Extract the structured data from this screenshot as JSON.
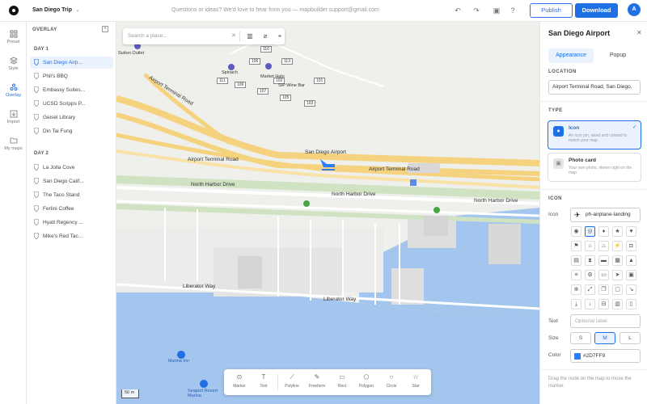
{
  "topbar": {
    "trip_title": "San Diego Trip",
    "feedback": "Questions or ideas? We'd love to hear from you — mapbuilder.support@gmail.com",
    "publish_label": "Publish",
    "download_label": "Download",
    "avatar_initial": "A"
  },
  "rail": {
    "items": [
      {
        "label": "Preset",
        "icon": "grid-icon"
      },
      {
        "label": "Style",
        "icon": "layers-icon"
      },
      {
        "label": "Overlay",
        "icon": "overlay-icon"
      },
      {
        "label": "Import",
        "icon": "import-icon"
      },
      {
        "label": "My maps",
        "icon": "folder-icon"
      }
    ]
  },
  "overlay": {
    "heading": "OVERLAY",
    "day1": {
      "heading": "DAY 1",
      "places": [
        "San Diego Airp...",
        "Phil's BBQ",
        "Embassy Suites...",
        "UCSD Scripps P...",
        "Geisel Library",
        "Din Tai Fung"
      ]
    },
    "day2": {
      "heading": "DAY 2",
      "places": [
        "La Jolla Cove",
        "San Diego Calif...",
        "The Taco Stand",
        "Ferlini Coffee",
        "Hyatt Regency ...",
        "Mike's Red Tac..."
      ]
    }
  },
  "map": {
    "search_placeholder": "Search a place...",
    "labels": {
      "airport": "San Diego Airport",
      "airport_terminal_1": "Airport Terminal Road",
      "airport_terminal_2": "Airport Terminal Road",
      "airport_terminal_diag": "Airport Terminal Road",
      "north_harbor_1": "North Harbor Drive",
      "north_harbor_2": "North Harbor Drive",
      "north_harbor_3": "North Harbor Drive",
      "liberator_1": "Liberator Way",
      "liberator_2": "Liberator Way",
      "market_halo": "Market Halo",
      "sip_wine_bar": "SIP Wine Bar",
      "spinach": "Spinach",
      "sutton_outlet": "Sutton Outlet",
      "marina": "Marina Inn",
      "seaport": "Seaport Resort Marina"
    },
    "route_numbers": [
      "110",
      "106",
      "113",
      "111",
      "109",
      "102",
      "107",
      "101",
      "105",
      "103"
    ],
    "scale": "50 m",
    "draw_tools": [
      {
        "label": "Marker",
        "icon": "marker-icon"
      },
      {
        "label": "Text",
        "icon": "text-icon"
      },
      {
        "label": "Polyline",
        "icon": "polyline-icon"
      },
      {
        "label": "Freeform",
        "icon": "freeform-icon"
      },
      {
        "label": "Rect",
        "icon": "rect-icon"
      },
      {
        "label": "Polygon",
        "icon": "polygon-icon"
      },
      {
        "label": "Circle",
        "icon": "circle-icon"
      },
      {
        "label": "Star",
        "icon": "star-icon"
      }
    ]
  },
  "inspector": {
    "title": "San Diego Airport",
    "tab_appearance": "Appearance",
    "tab_popup": "Popup",
    "location_heading": "LOCATION",
    "location_value": "Airport Terminal Road, San Diego,",
    "type_heading": "TYPE",
    "type_icon_title": "Icon",
    "type_icon_desc": "An icon pin, sized and colored to match your map",
    "type_photo_title": "Photo card",
    "type_photo_desc": "Your own photo, shown right on the map",
    "icon_heading": "ICON",
    "icon_label": "Icon",
    "icon_value": "ph-airplane-landing",
    "text_label": "Text",
    "text_placeholder": "Optional label",
    "size_label": "Size",
    "sizes": [
      "S",
      "M",
      "L"
    ],
    "color_label": "Color",
    "color_value": "#2D7FF9",
    "hint": "Drag the node on the map to move the marker."
  },
  "colors": {
    "accent": "#1f6fe5",
    "marker": "#2D7FF9",
    "water": "#a4c5ee",
    "road": "#f5d27e",
    "green": "#cfe3c3"
  }
}
